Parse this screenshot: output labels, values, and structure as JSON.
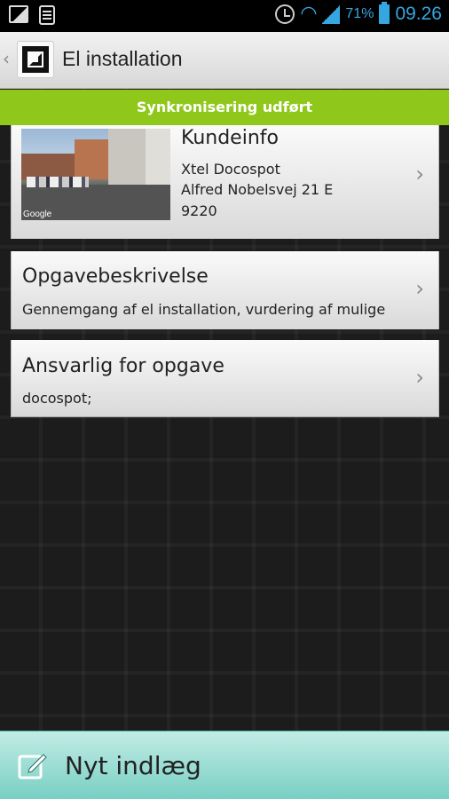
{
  "status_bar": {
    "left_icons": [
      "picture-icon",
      "notes-icon"
    ],
    "right_icons": [
      "alarm-icon",
      "wifi-icon",
      "signal-icon",
      "battery-icon"
    ],
    "battery": "71%",
    "time": "09.26"
  },
  "action_bar": {
    "title": "El installation",
    "back_icon": "chevron-left-icon",
    "logo_icon": "app-logo-icon"
  },
  "sync_banner": {
    "text": "Synkronisering udført",
    "color": "#8fc71a"
  },
  "customer_card": {
    "heading": "Kundeinfo",
    "lines": [
      "Xtel Docospot",
      "Alfred Nobelsvej 21 E",
      "9220"
    ],
    "map_watermark": "Google",
    "chevron": "›"
  },
  "task_card": {
    "title": "Opgavebeskrivelse",
    "description": "Gennemgang af el installation, vurdering af mulige",
    "chevron": "›"
  },
  "responsible_card": {
    "title": "Ansvarlig for opgave",
    "value": "docospot;",
    "chevron": "›"
  },
  "bottom_button": {
    "label": "Nyt indlæg",
    "icon": "edit-icon",
    "color": "#78cfc3"
  }
}
